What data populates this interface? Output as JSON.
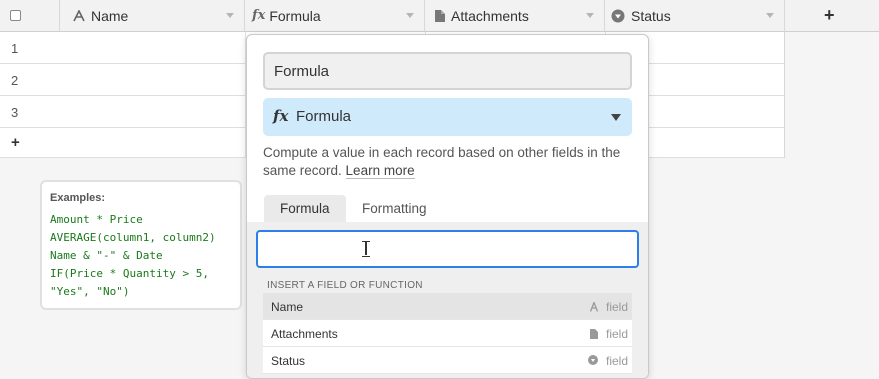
{
  "header": {
    "columns": [
      {
        "label": "Name",
        "icon": "text-icon"
      },
      {
        "label": "Formula",
        "icon": "formula-icon"
      },
      {
        "label": "Attachments",
        "icon": "attachment-icon"
      },
      {
        "label": "Status",
        "icon": "status-icon"
      }
    ],
    "add_column_label": "+"
  },
  "rows": [
    "1",
    "2",
    "3"
  ],
  "add_row_label": "+",
  "examples": {
    "title": "Examples:",
    "lines": [
      "Amount * Price",
      "AVERAGE(column1, column2)",
      "Name & \"-\" & Date",
      "IF(Price * Quantity > 5,",
      "\"Yes\", \"No\")"
    ]
  },
  "panel": {
    "field_name_value": "Formula",
    "field_type_label": "Formula",
    "description": "Compute a value in each record based on other fields in the same record.",
    "learn_more": "Learn more",
    "tabs": [
      "Formula",
      "Formatting"
    ],
    "formula_value": "",
    "insert_header": "INSERT A FIELD OR FUNCTION",
    "fields": [
      {
        "name": "Name",
        "tag": "field",
        "icon": "text-icon"
      },
      {
        "name": "Attachments",
        "tag": "field",
        "icon": "attachment-icon"
      },
      {
        "name": "Status",
        "tag": "field",
        "icon": "status-icon"
      }
    ]
  },
  "colors": {
    "accent_blue": "#2d7fe8",
    "type_highlight": "#cfeafb",
    "example_green": "#1a7a1a"
  }
}
